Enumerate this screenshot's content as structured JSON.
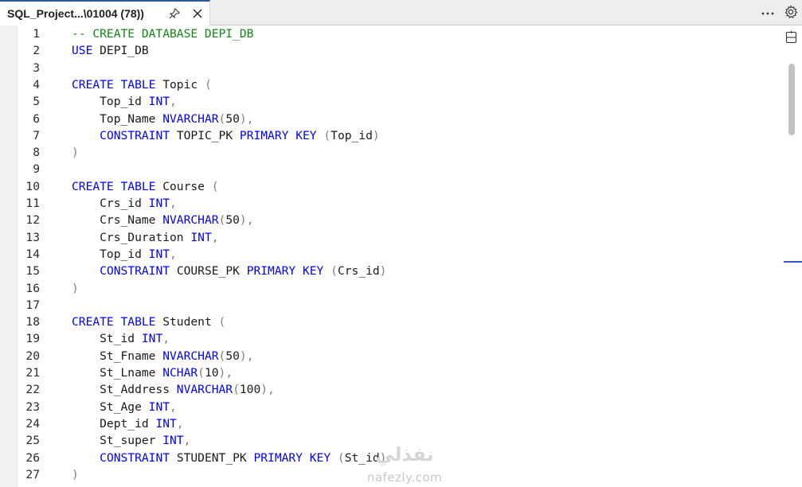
{
  "tab": {
    "title": "SQL_Project...\\01004 (78))",
    "pin_icon": "pin-icon",
    "close_icon": "close-icon"
  },
  "toolbar": {
    "more_icon": "more-icon",
    "settings_icon": "gear-icon",
    "split_icon": "split-editor-icon"
  },
  "colors": {
    "keyword": "#0000ff",
    "comment": "#118811",
    "punctuation": "#808080",
    "text": "#1a1a1a",
    "tab_accent": "#2b579a",
    "scroll_marker": "#3355cc"
  },
  "lines": [
    {
      "n": "1",
      "tokens": [
        {
          "t": "-- CREATE DATABASE DEPI_DB",
          "c": "c"
        }
      ]
    },
    {
      "n": "2",
      "tokens": [
        {
          "t": "USE",
          "c": "k"
        },
        {
          "t": " DEPI_DB",
          "c": ""
        }
      ]
    },
    {
      "n": "3",
      "tokens": []
    },
    {
      "n": "4",
      "tokens": [
        {
          "t": "CREATE",
          "c": "k"
        },
        {
          "t": " ",
          "c": ""
        },
        {
          "t": "TABLE",
          "c": "k"
        },
        {
          "t": " Topic ",
          "c": ""
        },
        {
          "t": "(",
          "c": "p"
        }
      ]
    },
    {
      "n": "5",
      "tokens": [
        {
          "t": "    Top_id ",
          "c": ""
        },
        {
          "t": "INT",
          "c": "k"
        },
        {
          "t": ",",
          "c": "p"
        }
      ]
    },
    {
      "n": "6",
      "tokens": [
        {
          "t": "    Top_Name ",
          "c": ""
        },
        {
          "t": "NVARCHAR",
          "c": "k"
        },
        {
          "t": "(",
          "c": "p"
        },
        {
          "t": "50",
          "c": ""
        },
        {
          "t": "),",
          "c": "p"
        }
      ]
    },
    {
      "n": "7",
      "tokens": [
        {
          "t": "    ",
          "c": ""
        },
        {
          "t": "CONSTRAINT",
          "c": "k"
        },
        {
          "t": " TOPIC_PK ",
          "c": ""
        },
        {
          "t": "PRIMARY KEY",
          "c": "k"
        },
        {
          "t": " ",
          "c": ""
        },
        {
          "t": "(",
          "c": "p"
        },
        {
          "t": "Top_id",
          "c": ""
        },
        {
          "t": ")",
          "c": "p"
        }
      ]
    },
    {
      "n": "8",
      "tokens": [
        {
          "t": ")",
          "c": "p"
        }
      ]
    },
    {
      "n": "9",
      "tokens": []
    },
    {
      "n": "10",
      "tokens": [
        {
          "t": "CREATE",
          "c": "k"
        },
        {
          "t": " ",
          "c": ""
        },
        {
          "t": "TABLE",
          "c": "k"
        },
        {
          "t": " Course ",
          "c": ""
        },
        {
          "t": "(",
          "c": "p"
        }
      ]
    },
    {
      "n": "11",
      "tokens": [
        {
          "t": "    Crs_id ",
          "c": ""
        },
        {
          "t": "INT",
          "c": "k"
        },
        {
          "t": ",",
          "c": "p"
        }
      ]
    },
    {
      "n": "12",
      "tokens": [
        {
          "t": "    Crs_Name ",
          "c": ""
        },
        {
          "t": "NVARCHAR",
          "c": "k"
        },
        {
          "t": "(",
          "c": "p"
        },
        {
          "t": "50",
          "c": ""
        },
        {
          "t": "),",
          "c": "p"
        }
      ]
    },
    {
      "n": "13",
      "tokens": [
        {
          "t": "    Crs_Duration ",
          "c": ""
        },
        {
          "t": "INT",
          "c": "k"
        },
        {
          "t": ",",
          "c": "p"
        }
      ]
    },
    {
      "n": "14",
      "tokens": [
        {
          "t": "    Top_id ",
          "c": ""
        },
        {
          "t": "INT",
          "c": "k"
        },
        {
          "t": ",",
          "c": "p"
        }
      ]
    },
    {
      "n": "15",
      "tokens": [
        {
          "t": "    ",
          "c": ""
        },
        {
          "t": "CONSTRAINT",
          "c": "k"
        },
        {
          "t": " COURSE_PK ",
          "c": ""
        },
        {
          "t": "PRIMARY KEY",
          "c": "k"
        },
        {
          "t": " ",
          "c": ""
        },
        {
          "t": "(",
          "c": "p"
        },
        {
          "t": "Crs_id",
          "c": ""
        },
        {
          "t": ")",
          "c": "p"
        }
      ]
    },
    {
      "n": "16",
      "tokens": [
        {
          "t": ")",
          "c": "p"
        }
      ]
    },
    {
      "n": "17",
      "tokens": []
    },
    {
      "n": "18",
      "tokens": [
        {
          "t": "CREATE",
          "c": "k"
        },
        {
          "t": " ",
          "c": ""
        },
        {
          "t": "TABLE",
          "c": "k"
        },
        {
          "t": " Student ",
          "c": ""
        },
        {
          "t": "(",
          "c": "p"
        }
      ]
    },
    {
      "n": "19",
      "tokens": [
        {
          "t": "    St_id ",
          "c": ""
        },
        {
          "t": "INT",
          "c": "k"
        },
        {
          "t": ",",
          "c": "p"
        }
      ]
    },
    {
      "n": "20",
      "tokens": [
        {
          "t": "    St_Fname ",
          "c": ""
        },
        {
          "t": "NVARCHAR",
          "c": "k"
        },
        {
          "t": "(",
          "c": "p"
        },
        {
          "t": "50",
          "c": ""
        },
        {
          "t": "),",
          "c": "p"
        }
      ]
    },
    {
      "n": "21",
      "tokens": [
        {
          "t": "    St_Lname ",
          "c": ""
        },
        {
          "t": "NCHAR",
          "c": "k"
        },
        {
          "t": "(",
          "c": "p"
        },
        {
          "t": "10",
          "c": ""
        },
        {
          "t": "),",
          "c": "p"
        }
      ]
    },
    {
      "n": "22",
      "tokens": [
        {
          "t": "    St_Address ",
          "c": ""
        },
        {
          "t": "NVARCHAR",
          "c": "k"
        },
        {
          "t": "(",
          "c": "p"
        },
        {
          "t": "100",
          "c": ""
        },
        {
          "t": "),",
          "c": "p"
        }
      ]
    },
    {
      "n": "23",
      "tokens": [
        {
          "t": "    St_Age ",
          "c": ""
        },
        {
          "t": "INT",
          "c": "k"
        },
        {
          "t": ",",
          "c": "p"
        }
      ]
    },
    {
      "n": "24",
      "tokens": [
        {
          "t": "    Dept_id ",
          "c": ""
        },
        {
          "t": "INT",
          "c": "k"
        },
        {
          "t": ",",
          "c": "p"
        }
      ]
    },
    {
      "n": "25",
      "tokens": [
        {
          "t": "    St_super ",
          "c": ""
        },
        {
          "t": "INT",
          "c": "k"
        },
        {
          "t": ",",
          "c": "p"
        }
      ]
    },
    {
      "n": "26",
      "tokens": [
        {
          "t": "    ",
          "c": ""
        },
        {
          "t": "CONSTRAINT",
          "c": "k"
        },
        {
          "t": " STUDENT_PK ",
          "c": ""
        },
        {
          "t": "PRIMARY KEY",
          "c": "k"
        },
        {
          "t": " ",
          "c": ""
        },
        {
          "t": "(",
          "c": "p"
        },
        {
          "t": "St_id",
          "c": ""
        },
        {
          "t": ")",
          "c": "p"
        }
      ]
    },
    {
      "n": "27",
      "tokens": [
        {
          "t": ")",
          "c": "p"
        }
      ]
    }
  ],
  "watermark": {
    "logo": "نفذلي",
    "site": "nafezly.com"
  }
}
